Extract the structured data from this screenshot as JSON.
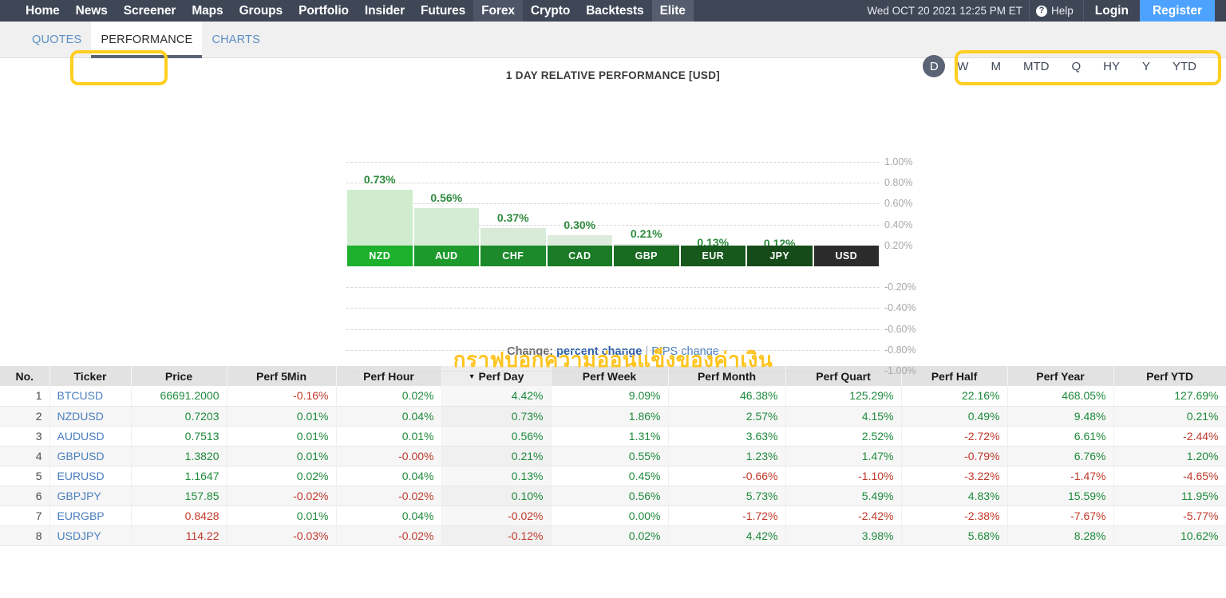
{
  "topnav": {
    "items": [
      {
        "label": "Home",
        "state": "normal"
      },
      {
        "label": "News",
        "state": "normal"
      },
      {
        "label": "Screener",
        "state": "normal"
      },
      {
        "label": "Maps",
        "state": "normal"
      },
      {
        "label": "Groups",
        "state": "normal"
      },
      {
        "label": "Portfolio",
        "state": "normal"
      },
      {
        "label": "Insider",
        "state": "normal"
      },
      {
        "label": "Futures",
        "state": "normal"
      },
      {
        "label": "Forex",
        "state": "active"
      },
      {
        "label": "Crypto",
        "state": "normal"
      },
      {
        "label": "Backtests",
        "state": "normal"
      },
      {
        "label": "Elite",
        "state": "elite"
      }
    ],
    "datetime": "Wed OCT 20 2021 12:25 PM ET",
    "help_label": "Help",
    "help_icon": "question-mark-icon",
    "login_label": "Login",
    "register_label": "Register",
    "register_color": "#4da2ff",
    "bar_color": "#3f4757"
  },
  "subbar": {
    "tabs": [
      {
        "label": "QUOTES",
        "selected": false
      },
      {
        "label": "PERFORMANCE",
        "selected": true
      },
      {
        "label": "CHARTS",
        "selected": false
      }
    ],
    "periods": [
      {
        "label": "D",
        "selected": true
      },
      {
        "label": "W",
        "selected": false
      },
      {
        "label": "M",
        "selected": false
      },
      {
        "label": "MTD",
        "selected": false
      },
      {
        "label": "Q",
        "selected": false
      },
      {
        "label": "HY",
        "selected": false
      },
      {
        "label": "Y",
        "selected": false
      },
      {
        "label": "YTD",
        "selected": false
      }
    ],
    "highlight_color": "#ffce1f"
  },
  "annotation": {
    "thai_note": "กราฟบอกความอ่อนแข็งของค่าเงิน",
    "color": "#ffc41f"
  },
  "chart_data": {
    "type": "bar",
    "title": "1 DAY RELATIVE PERFORMANCE [USD]",
    "xlabel": "",
    "ylabel": "",
    "ylim": [
      -1.0,
      1.0
    ],
    "ytick_labels": [
      "1.00%",
      "0.80%",
      "0.60%",
      "0.40%",
      "0.20%",
      "-0.20%",
      "-0.40%",
      "-0.60%",
      "-0.80%",
      "-1.00%"
    ],
    "ytick_values": [
      1.0,
      0.8,
      0.6,
      0.4,
      0.2,
      -0.2,
      -0.4,
      -0.6,
      -0.8,
      -1.0
    ],
    "grid": true,
    "legend": "none",
    "categories": [
      "NZD",
      "AUD",
      "CHF",
      "CAD",
      "GBP",
      "EUR",
      "JPY",
      "USD"
    ],
    "values": [
      0.73,
      0.56,
      0.37,
      0.3,
      0.21,
      0.13,
      0.12,
      0.0
    ],
    "value_labels": [
      "0.73%",
      "0.56%",
      "0.37%",
      "0.30%",
      "0.21%",
      "0.13%",
      "0.12%",
      ""
    ],
    "bar_fill_colors": [
      "#cfeccf",
      "#d3ecd3",
      "#d8ebd8",
      "#dcebdc",
      "#e0e8e0",
      "#e4e5e4",
      "#e4e5e4",
      "#ffffff"
    ],
    "label_colors": [
      "#1cb02c",
      "#1e9a2d",
      "#1c8a2a",
      "#1a7a26",
      "#196b22",
      "#17581d",
      "#154a19",
      "#2b2b2b"
    ],
    "value_label_color": "#2e8b3d"
  },
  "change_row": {
    "label": "Change:",
    "percent_option": "percent change",
    "separator": "|",
    "pips_option": "PIPS change"
  },
  "table": {
    "headers": [
      "No.",
      "Ticker",
      "Price",
      "Perf 5Min",
      "Perf Hour",
      "Perf Day",
      "Perf Week",
      "Perf Month",
      "Perf Quart",
      "Perf Half",
      "Perf Year",
      "Perf YTD"
    ],
    "sorted_column": "Perf Day",
    "sort_direction": "desc",
    "rows": [
      {
        "no": "1",
        "ticker": "BTCUSD",
        "price": "66691.2000",
        "price_sign": "pos",
        "cells": [
          {
            "v": "-0.16%",
            "s": "neg"
          },
          {
            "v": "0.02%",
            "s": "pos"
          },
          {
            "v": "4.42%",
            "s": "pos"
          },
          {
            "v": "9.09%",
            "s": "pos"
          },
          {
            "v": "46.38%",
            "s": "pos"
          },
          {
            "v": "125.29%",
            "s": "pos"
          },
          {
            "v": "22.16%",
            "s": "pos"
          },
          {
            "v": "468.05%",
            "s": "pos"
          },
          {
            "v": "127.69%",
            "s": "pos"
          }
        ]
      },
      {
        "no": "2",
        "ticker": "NZDUSD",
        "price": "0.7203",
        "price_sign": "pos",
        "cells": [
          {
            "v": "0.01%",
            "s": "pos"
          },
          {
            "v": "0.04%",
            "s": "pos"
          },
          {
            "v": "0.73%",
            "s": "pos"
          },
          {
            "v": "1.86%",
            "s": "pos"
          },
          {
            "v": "2.57%",
            "s": "pos"
          },
          {
            "v": "4.15%",
            "s": "pos"
          },
          {
            "v": "0.49%",
            "s": "pos"
          },
          {
            "v": "9.48%",
            "s": "pos"
          },
          {
            "v": "0.21%",
            "s": "pos"
          }
        ]
      },
      {
        "no": "3",
        "ticker": "AUDUSD",
        "price": "0.7513",
        "price_sign": "pos",
        "cells": [
          {
            "v": "0.01%",
            "s": "pos"
          },
          {
            "v": "0.01%",
            "s": "pos"
          },
          {
            "v": "0.56%",
            "s": "pos"
          },
          {
            "v": "1.31%",
            "s": "pos"
          },
          {
            "v": "3.63%",
            "s": "pos"
          },
          {
            "v": "2.52%",
            "s": "pos"
          },
          {
            "v": "-2.72%",
            "s": "neg"
          },
          {
            "v": "6.61%",
            "s": "pos"
          },
          {
            "v": "-2.44%",
            "s": "neg"
          }
        ]
      },
      {
        "no": "4",
        "ticker": "GBPUSD",
        "price": "1.3820",
        "price_sign": "pos",
        "cells": [
          {
            "v": "0.01%",
            "s": "pos"
          },
          {
            "v": "-0.00%",
            "s": "neg"
          },
          {
            "v": "0.21%",
            "s": "pos"
          },
          {
            "v": "0.55%",
            "s": "pos"
          },
          {
            "v": "1.23%",
            "s": "pos"
          },
          {
            "v": "1.47%",
            "s": "pos"
          },
          {
            "v": "-0.79%",
            "s": "neg"
          },
          {
            "v": "6.76%",
            "s": "pos"
          },
          {
            "v": "1.20%",
            "s": "pos"
          }
        ]
      },
      {
        "no": "5",
        "ticker": "EURUSD",
        "price": "1.1647",
        "price_sign": "pos",
        "cells": [
          {
            "v": "0.02%",
            "s": "pos"
          },
          {
            "v": "0.04%",
            "s": "pos"
          },
          {
            "v": "0.13%",
            "s": "pos"
          },
          {
            "v": "0.45%",
            "s": "pos"
          },
          {
            "v": "-0.66%",
            "s": "neg"
          },
          {
            "v": "-1.10%",
            "s": "neg"
          },
          {
            "v": "-3.22%",
            "s": "neg"
          },
          {
            "v": "-1.47%",
            "s": "neg"
          },
          {
            "v": "-4.65%",
            "s": "neg"
          }
        ]
      },
      {
        "no": "6",
        "ticker": "GBPJPY",
        "price": "157.85",
        "price_sign": "pos",
        "cells": [
          {
            "v": "-0.02%",
            "s": "neg"
          },
          {
            "v": "-0.02%",
            "s": "neg"
          },
          {
            "v": "0.10%",
            "s": "pos"
          },
          {
            "v": "0.56%",
            "s": "pos"
          },
          {
            "v": "5.73%",
            "s": "pos"
          },
          {
            "v": "5.49%",
            "s": "pos"
          },
          {
            "v": "4.83%",
            "s": "pos"
          },
          {
            "v": "15.59%",
            "s": "pos"
          },
          {
            "v": "11.95%",
            "s": "pos"
          }
        ]
      },
      {
        "no": "7",
        "ticker": "EURGBP",
        "price": "0.8428",
        "price_sign": "neg",
        "cells": [
          {
            "v": "0.01%",
            "s": "pos"
          },
          {
            "v": "0.04%",
            "s": "pos"
          },
          {
            "v": "-0.02%",
            "s": "neg"
          },
          {
            "v": "0.00%",
            "s": "pos"
          },
          {
            "v": "-1.72%",
            "s": "neg"
          },
          {
            "v": "-2.42%",
            "s": "neg"
          },
          {
            "v": "-2.38%",
            "s": "neg"
          },
          {
            "v": "-7.67%",
            "s": "neg"
          },
          {
            "v": "-5.77%",
            "s": "neg"
          }
        ]
      },
      {
        "no": "8",
        "ticker": "USDJPY",
        "price": "114.22",
        "price_sign": "neg",
        "cells": [
          {
            "v": "-0.03%",
            "s": "neg"
          },
          {
            "v": "-0.02%",
            "s": "neg"
          },
          {
            "v": "-0.12%",
            "s": "neg"
          },
          {
            "v": "0.02%",
            "s": "pos"
          },
          {
            "v": "4.42%",
            "s": "pos"
          },
          {
            "v": "3.98%",
            "s": "pos"
          },
          {
            "v": "5.68%",
            "s": "pos"
          },
          {
            "v": "8.28%",
            "s": "pos"
          },
          {
            "v": "10.62%",
            "s": "pos"
          }
        ]
      }
    ]
  }
}
